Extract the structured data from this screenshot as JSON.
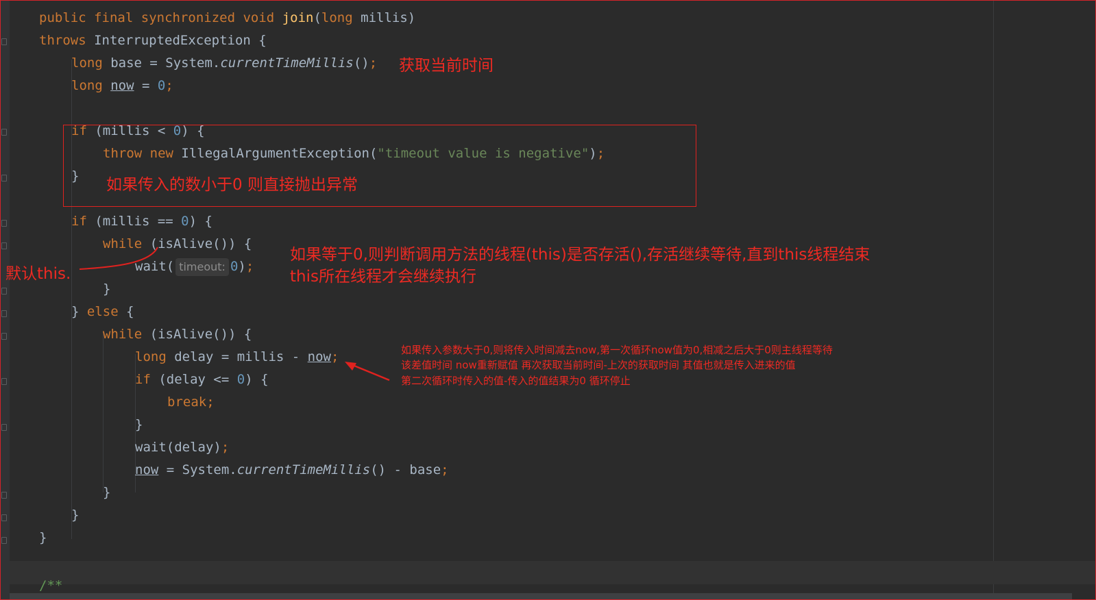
{
  "code": {
    "line01": {
      "k1": "public",
      "k2": "final",
      "k3": "synchronized",
      "k4": "void",
      "name": "join",
      "p1": "(",
      "k5": "long",
      "p2": " millis)"
    },
    "line02": {
      "k1": "throws",
      "rest": " InterruptedException {"
    },
    "line03": {
      "k1": "long",
      "a": " base = System.",
      "call": "currentTimeMillis",
      "b": "()",
      "semi": ";"
    },
    "line04": {
      "k1": "long",
      "sp": " ",
      "var": "now",
      "eq": " = ",
      "num": "0",
      "semi": ";"
    },
    "line05": {
      "k1": "if",
      "a": " (millis < ",
      "num": "0",
      "b": ") {"
    },
    "line06": {
      "k1": "throw",
      "sp": " ",
      "k2": "new",
      "a": " IllegalArgumentException(",
      "str": "\"timeout value is negative\"",
      "b": ")",
      "semi": ";"
    },
    "line07": {
      "text": "}"
    },
    "line08": {
      "k1": "if",
      "a": " (millis == ",
      "num": "0",
      "b": ") {"
    },
    "line09": {
      "k1": "while",
      "a": " (isAlive()) {"
    },
    "line10": {
      "a": "wait(",
      "hint": "timeout:",
      "num": "0",
      "b": ")",
      "semi": ";"
    },
    "line11": {
      "text": "}"
    },
    "line12": {
      "a": "} ",
      "k1": "else",
      "b": " {"
    },
    "line13": {
      "k1": "while",
      "a": " (isAlive()) {"
    },
    "line14": {
      "k1": "long",
      "a": " delay = millis - ",
      "var": "now",
      "semi": ";"
    },
    "line15": {
      "k1": "if",
      "a": " (delay <= ",
      "num": "0",
      "b": ") {"
    },
    "line16": {
      "k1": "break",
      "semi": ";"
    },
    "line17": {
      "text": "}"
    },
    "line18": {
      "a": "wait(delay)",
      "semi": ";"
    },
    "line19": {
      "var": "now",
      "a": " = System.",
      "call": "currentTimeMillis",
      "b": "() - base",
      "semi": ";"
    },
    "line20": {
      "text": "}"
    },
    "line21": {
      "text": "}"
    },
    "line22": {
      "text": "}"
    },
    "line23": {
      "text": "/**"
    }
  },
  "annotations": {
    "current_time": "获取当前时间",
    "negative_throw": "如果传入的数小于0  则直接抛出异常",
    "default_this": "默认this.",
    "zero_line1": "如果等于0,则判断调用方法的线程(this)是否存活(),存活继续等待,直到this线程结束",
    "zero_line2": "this所在线程才会继续执行",
    "positive_line1": "如果传入参数大于0,则将传入时间减去now,第一次循环now值为0,相减之后大于0则主线程等待",
    "positive_line2": "该差值时间  now重新赋值  再次获取当前时间-上次的获取时间  其值也就是传入进来的值",
    "positive_line3": "第二次循环时传入的值-传入的值结果为0  循环停止"
  },
  "colors": {
    "background": "#2b2b2b",
    "keyword": "#cc7832",
    "annotation": "#ee2a23",
    "string": "#6a8759",
    "number": "#6897bb",
    "method": "#ffc66d"
  }
}
